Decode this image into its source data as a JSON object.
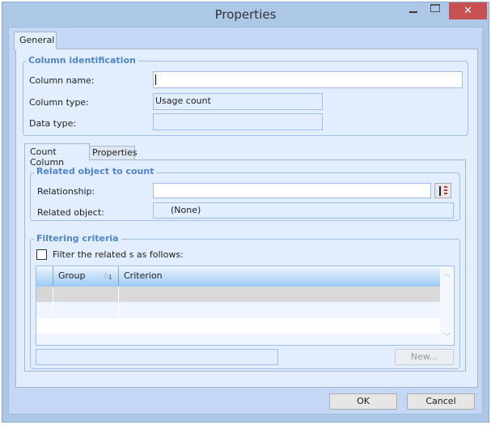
{
  "window": {
    "title": "Properties"
  },
  "tabs": {
    "general": "General"
  },
  "column_identification": {
    "title": "Column identification",
    "column_name_label": "Column name:",
    "column_name_value": "",
    "column_type_label": "Column type:",
    "column_type_value": "Usage count",
    "data_type_label": "Data type:",
    "data_type_value": ""
  },
  "inner_tabs": {
    "count_column": "Count Column",
    "properties": "Properties"
  },
  "related": {
    "title": "Related object to count",
    "relationship_label": "Relationship:",
    "relationship_value": "",
    "related_object_label": "Related object:",
    "related_object_value": "(None)"
  },
  "filtering": {
    "title": "Filtering criteria",
    "checkbox_label": "Filter the related s as follows:",
    "checked": false,
    "columns": [
      "Group",
      "Criterion"
    ],
    "sort_indicator": "1",
    "new_button": "New..."
  },
  "footer": {
    "ok": "OK",
    "cancel": "Cancel"
  }
}
